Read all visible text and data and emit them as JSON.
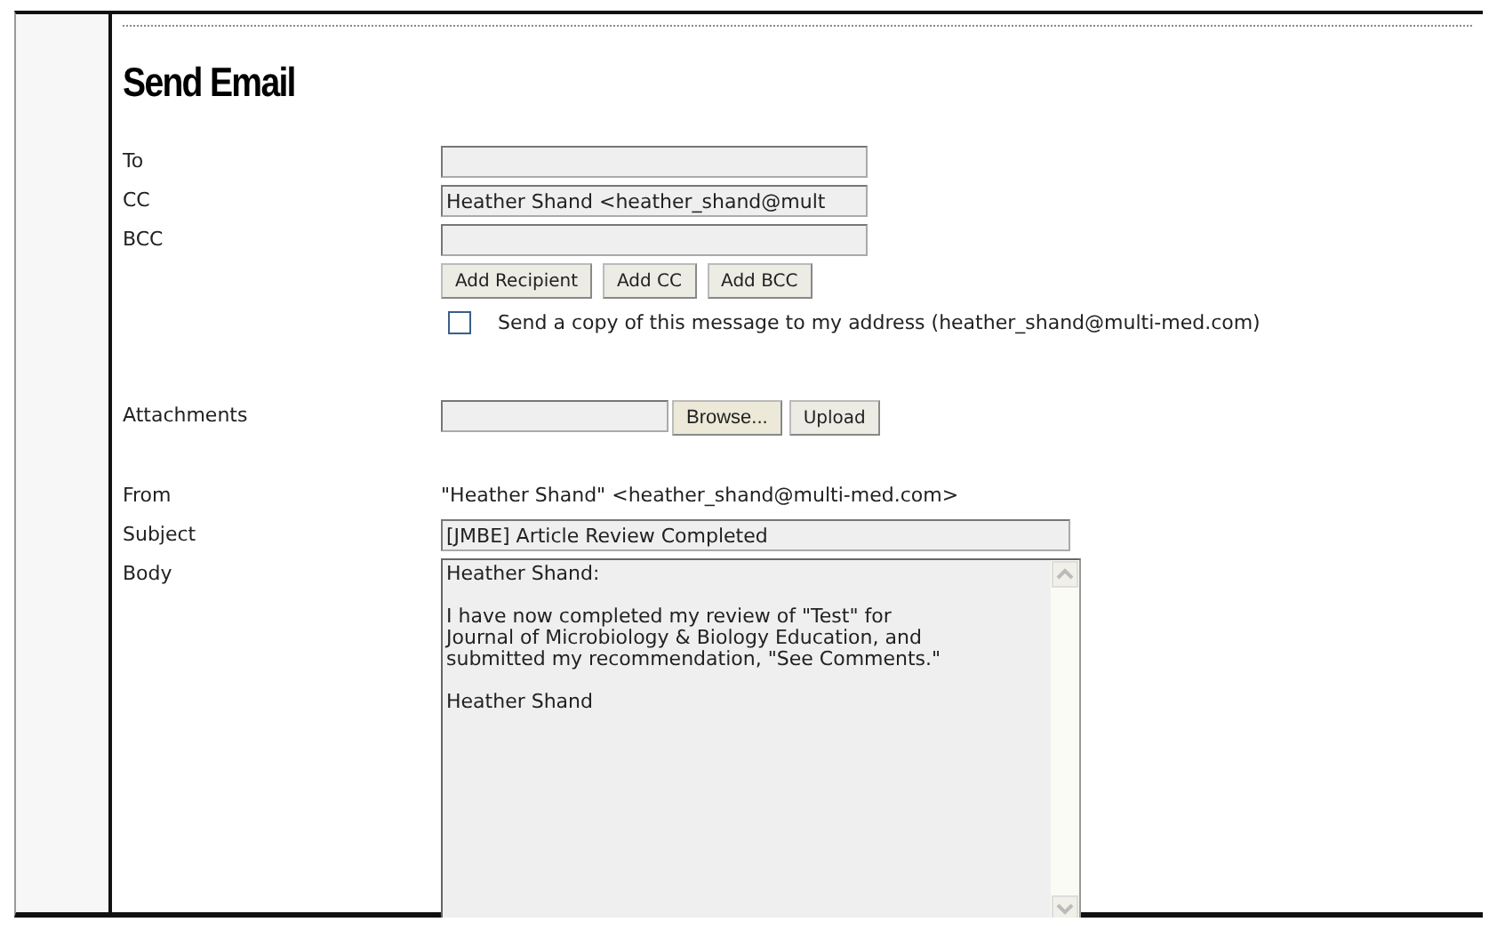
{
  "title": "Send Email",
  "recipients": [
    {
      "label": "To"
    },
    {
      "label": "CC",
      "value": "Heather Shand <heather_shand@mult"
    },
    {
      "label": "BCC"
    }
  ],
  "recipient_buttons": [
    "Add Recipient",
    "Add CC",
    "Add BCC"
  ],
  "copy_to_self": {
    "label": "Send a copy of this message to my address (heather_shand@multi-med.com)",
    "checked": false
  },
  "attachments": {
    "label": "Attachments",
    "browse_button": "Browse...",
    "upload_button": "Upload"
  },
  "from": {
    "label": "From",
    "value": "\"Heather Shand\" <heather_shand@multi-med.com>"
  },
  "subject": {
    "label": "Subject",
    "value": "[JMBE] Article Review Completed"
  },
  "body": {
    "label": "Body",
    "value": "Heather Shand:\n\nI have now completed my review of \"Test\" for\nJournal of Microbiology & Biology Education, and\nsubmitted my recommendation, \"See Comments.\"\n\nHeather Shand"
  }
}
